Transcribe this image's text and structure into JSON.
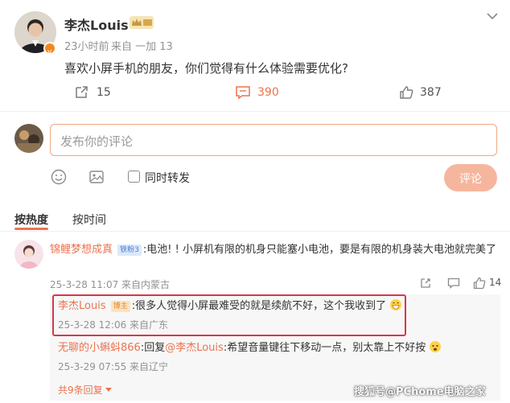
{
  "post": {
    "author": "李杰Louis",
    "author_badge": "vip-crown-badge",
    "time": "23小时前",
    "source": "来自 一加 13",
    "text": "喜欢小屏手机的朋友，你们觉得有什么体验需要优化?",
    "more_icon": "chevron-down-icon",
    "actions": {
      "repost_count": "15",
      "comment_count": "390",
      "like_count": "387"
    }
  },
  "composer": {
    "placeholder": "发布你的评论",
    "also_repost_label": "同时转发",
    "submit_label": "评论"
  },
  "sort_tabs": [
    "按热度",
    "按时间"
  ],
  "comment": {
    "author": "锦鲤梦想成真",
    "badge": "铁粉3",
    "text": ":电池! ! 小屏机有限的机身只能塞小电池，要是有限的机身装大电池就完美了",
    "meta": "25-3-28 11:07 来自内蒙古",
    "like_count": "14",
    "replies": [
      {
        "author": "李杰Louis",
        "badge": "博主",
        "text": ":很多人觉得小屏最难受的就是续航不好，这个我收到了",
        "meta": "25-3-28 12:06 来自广东"
      },
      {
        "author": "无聊的小蝌蚪866",
        "reply_prefix": ":回复",
        "reply_to": "@李杰Louis",
        "text": ":希望音量键往下移动一点，别太靠上不好按",
        "meta": "25-3-29 07:55 来自辽宁"
      }
    ],
    "more_replies": "共9条回复"
  },
  "watermark": "搜狐号@PChome电脑之家",
  "colors": {
    "accent": "#eb7350",
    "highlight_border": "#d6384a",
    "submit_bg": "#f6b69e",
    "muted": "#939393"
  }
}
